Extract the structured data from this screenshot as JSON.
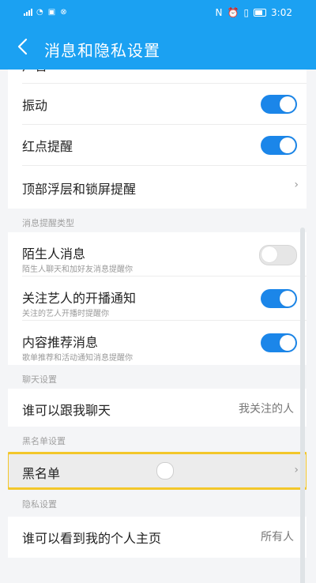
{
  "status": {
    "time": "3:02"
  },
  "header": {
    "title": "消息和隐私设置"
  },
  "rows": {
    "top_partial": {
      "label": "声音",
      "toggle_on": true
    },
    "vibrate": {
      "label": "振动",
      "toggle_on": true
    },
    "red_dot": {
      "label": "红点提醒",
      "toggle_on": true
    },
    "overlay_lock": {
      "label": "顶部浮层和锁屏提醒"
    }
  },
  "sections": {
    "msg_types": "消息提醒类型",
    "chat": "聊天设置",
    "blacklist": "黑名单设置",
    "privacy": "隐私设置"
  },
  "msg_types": [
    {
      "label": "陌生人消息",
      "sub": "陌生人聊天和加好友消息提醒你",
      "toggle_on": false
    },
    {
      "label": "关注艺人的开播通知",
      "sub": "关注的艺人开播时提醒你",
      "toggle_on": true
    },
    {
      "label": "内容推荐消息",
      "sub": "歌单推荐和活动通知消息提醒你",
      "toggle_on": true
    }
  ],
  "chat": {
    "label": "谁可以跟我聊天",
    "value": "我关注的人"
  },
  "blacklist": {
    "label": "黑名单"
  },
  "privacy": {
    "label": "谁可以看到我的个人主页",
    "value": "所有人"
  },
  "colors": {
    "accent": "#1ba1f2",
    "toggle_on": "#1b86e9",
    "highlight": "#f3c72a"
  }
}
